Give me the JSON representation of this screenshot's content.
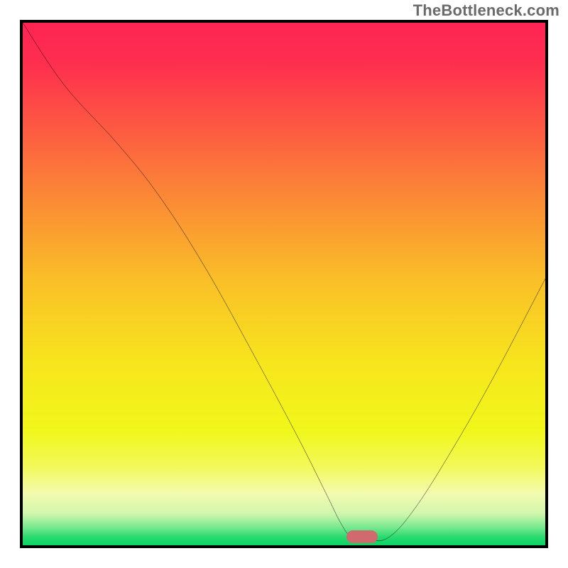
{
  "watermark": "TheBottleneck.com",
  "chart_data": {
    "type": "line",
    "title": "",
    "xlabel": "",
    "ylabel": "",
    "ylim": [
      0,
      100
    ],
    "xlim": [
      0,
      100
    ],
    "x": [
      0,
      8,
      18,
      26,
      35,
      45,
      53,
      58,
      61,
      63,
      66,
      70,
      75,
      82,
      90,
      100
    ],
    "values": [
      100,
      88,
      77,
      67,
      53,
      35,
      20,
      10,
      4,
      1.5,
      1,
      1.5,
      7,
      18,
      32,
      51
    ],
    "marker": {
      "x": 65,
      "y": 1.6,
      "color": "#d06a6f"
    },
    "bg_gradient": {
      "stops": [
        {
          "offset": 0.0,
          "color": "#fe2454"
        },
        {
          "offset": 0.08,
          "color": "#fe2f4e"
        },
        {
          "offset": 0.2,
          "color": "#fd5942"
        },
        {
          "offset": 0.35,
          "color": "#fb8e34"
        },
        {
          "offset": 0.5,
          "color": "#fac127"
        },
        {
          "offset": 0.65,
          "color": "#f7e51d"
        },
        {
          "offset": 0.78,
          "color": "#f1f71a"
        },
        {
          "offset": 0.85,
          "color": "#f2f95a"
        },
        {
          "offset": 0.9,
          "color": "#f4fbae"
        },
        {
          "offset": 0.94,
          "color": "#cff6ad"
        },
        {
          "offset": 0.965,
          "color": "#7be990"
        },
        {
          "offset": 0.985,
          "color": "#26da6e"
        },
        {
          "offset": 1.0,
          "color": "#0bd366"
        }
      ]
    }
  }
}
